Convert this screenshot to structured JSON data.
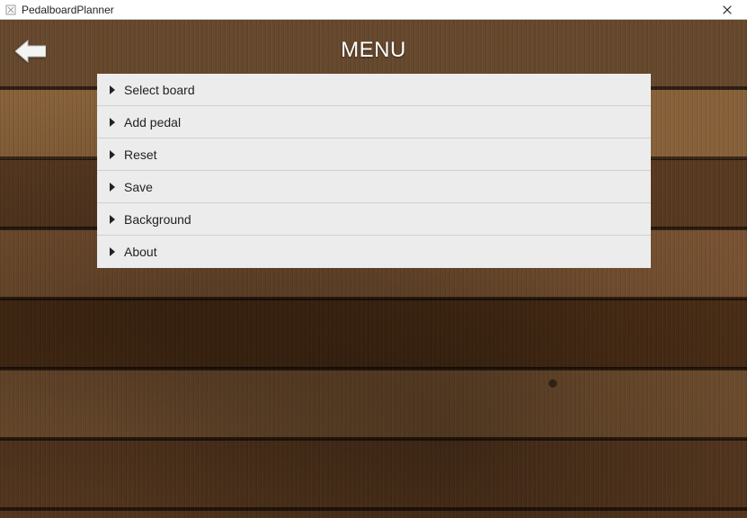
{
  "window": {
    "title": "PedalboardPlanner"
  },
  "header": {
    "title": "MENU"
  },
  "menu": {
    "items": [
      {
        "label": "Select board"
      },
      {
        "label": "Add pedal"
      },
      {
        "label": "Reset"
      },
      {
        "label": "Save"
      },
      {
        "label": "Background"
      },
      {
        "label": "About"
      }
    ]
  }
}
